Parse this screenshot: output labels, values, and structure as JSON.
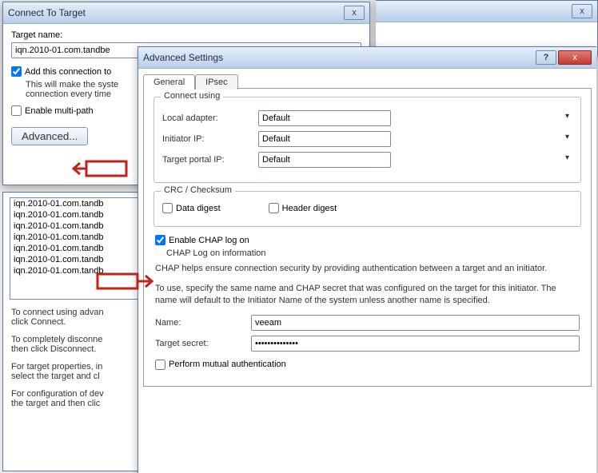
{
  "back_window": {
    "close_x": "x"
  },
  "connect": {
    "title": "Connect To Target",
    "close_x": "x",
    "target_name_label": "Target name:",
    "target_name_value": "iqn.2010-01.com.tandbe",
    "add_connect_label": "Add this connection to",
    "add_connect_line2": "This will make the syste",
    "add_connect_line3": "connection every time",
    "enable_multipath_label": "Enable multi-path",
    "advanced_btn": "Advanced..."
  },
  "listarea": {
    "items": [
      "iqn.2010-01.com.tandb",
      "iqn.2010-01.com.tandb",
      "iqn.2010-01.com.tandb",
      "iqn.2010-01.com.tandb",
      "iqn.2010-01.com.tandb",
      "iqn.2010-01.com.tandb",
      "iqn.2010-01.com.tandb"
    ],
    "p1": "To connect using advan",
    "p1b": "click Connect.",
    "p2": "To completely disconne",
    "p2b": "then click Disconnect.",
    "p3": "For target properties, in",
    "p3b": "select the target and cl",
    "p4": "For configuration of dev",
    "p4b": "the target and then clic"
  },
  "adv": {
    "title": "Advanced Settings",
    "help": "?",
    "close_x": "x",
    "tab_general": "General",
    "tab_ipsec": "IPsec",
    "connect_using_legend": "Connect using",
    "local_adapter_label": "Local adapter:",
    "local_adapter_value": "Default",
    "initiator_ip_label": "Initiator IP:",
    "initiator_ip_value": "Default",
    "target_portal_label": "Target portal IP:",
    "target_portal_value": "Default",
    "crc_legend": "CRC / Checksum",
    "data_digest_label": "Data digest",
    "header_digest_label": "Header digest",
    "enable_chap_label": "Enable CHAP log on",
    "chap_info_legend": "CHAP Log on information",
    "chap_help1": "CHAP helps ensure connection security by providing authentication between a target and an initiator.",
    "chap_help2": "To use, specify the same name and CHAP secret that was configured on the target for this initiator. The name will default to the Initiator Name of the system unless another name is specified.",
    "name_label": "Name:",
    "name_value": "veeam",
    "secret_label": "Target secret:",
    "secret_value": "••••••••••••••",
    "mutual_auth_label": "Perform mutual authentication"
  }
}
